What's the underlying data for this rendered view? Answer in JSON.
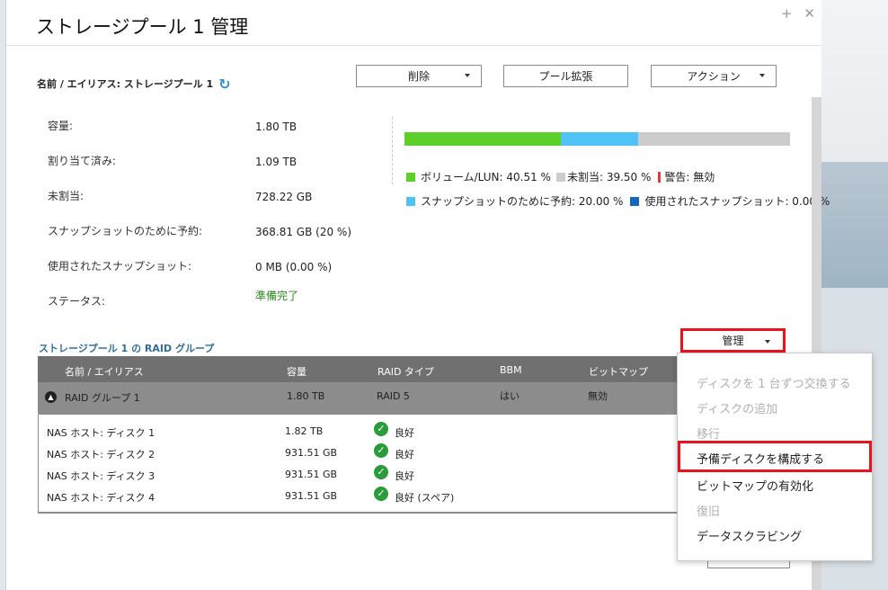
{
  "dialog": {
    "title": "ストレージプール 1 管理",
    "close_controls": "+ ✕"
  },
  "pool": {
    "name_label": "名前 / エイリアス: ストレージプール 1",
    "buttons": {
      "delete": "削除",
      "expand": "プール拡張",
      "action": "アクション"
    }
  },
  "info": {
    "capacity_label": "容量:",
    "capacity_value": "1.80 TB",
    "allocated_label": "割り当て済み:",
    "allocated_value": "1.09 TB",
    "unallocated_label": "未割当:",
    "unallocated_value": "728.22 GB",
    "snapshot_reserved_label": "スナップショットのために予約:",
    "snapshot_reserved_value": "368.81 GB (20 %)",
    "snapshot_used_label": "使用されたスナップショット:",
    "snapshot_used_value": "0 MB (0.00 %)",
    "status_label": "ステータス:",
    "status_value": "準備完了"
  },
  "usage_bar": {
    "volume_pct": 40.51,
    "snapshot_reserved_pct": 20.0,
    "colors": {
      "volume": "#5ccf2a",
      "snapshot_reserved": "#4fc3f7",
      "unallocated": "#cccccc",
      "warning": "#e03c3c",
      "snapshot_used": "#1565c0",
      "status_ok": "#2a8a1a"
    },
    "legend": {
      "volume": "ボリューム/LUN: 40.51 %",
      "unallocated": "未割当: 39.50 %",
      "warning": "警告: 無効",
      "snapshot_reserved": "スナップショットのために予約: 20.00 %",
      "snapshot_used": "使用されたスナップショット: 0.00 %"
    }
  },
  "raid_section": {
    "title": "ストレージプール 1 の RAID グループ",
    "manage_button": "管理",
    "headers": [
      "名前 / エイリアス",
      "容量",
      "RAID タイプ",
      "BBM",
      "ビットマップ"
    ],
    "group": {
      "name": "RAID グループ 1",
      "capacity": "1.80 TB",
      "raid_type": "RAID 5",
      "bbm": "はい",
      "bitmap": "無効"
    },
    "disks": [
      {
        "name": "NAS ホスト: ディスク 1",
        "capacity": "1.82 TB",
        "status": "良好"
      },
      {
        "name": "NAS ホスト: ディスク 2",
        "capacity": "931.51 GB",
        "status": "良好"
      },
      {
        "name": "NAS ホスト: ディスク 3",
        "capacity": "931.51 GB",
        "status": "良好"
      },
      {
        "name": "NAS ホスト: ディスク 4",
        "capacity": "931.51 GB",
        "status": "良好 (スペア)"
      }
    ]
  },
  "manage_menu": {
    "items": [
      {
        "label": "ディスクを 1 台ずつ交換する",
        "enabled": false
      },
      {
        "label": "ディスクの追加",
        "enabled": false
      },
      {
        "label": "移行",
        "enabled": false
      },
      {
        "label": "予備ディスクを構成する",
        "enabled": true
      },
      {
        "label": "ビットマップの有効化",
        "enabled": true
      },
      {
        "label": "復旧",
        "enabled": false
      },
      {
        "label": "データスクラビング",
        "enabled": true
      }
    ]
  }
}
